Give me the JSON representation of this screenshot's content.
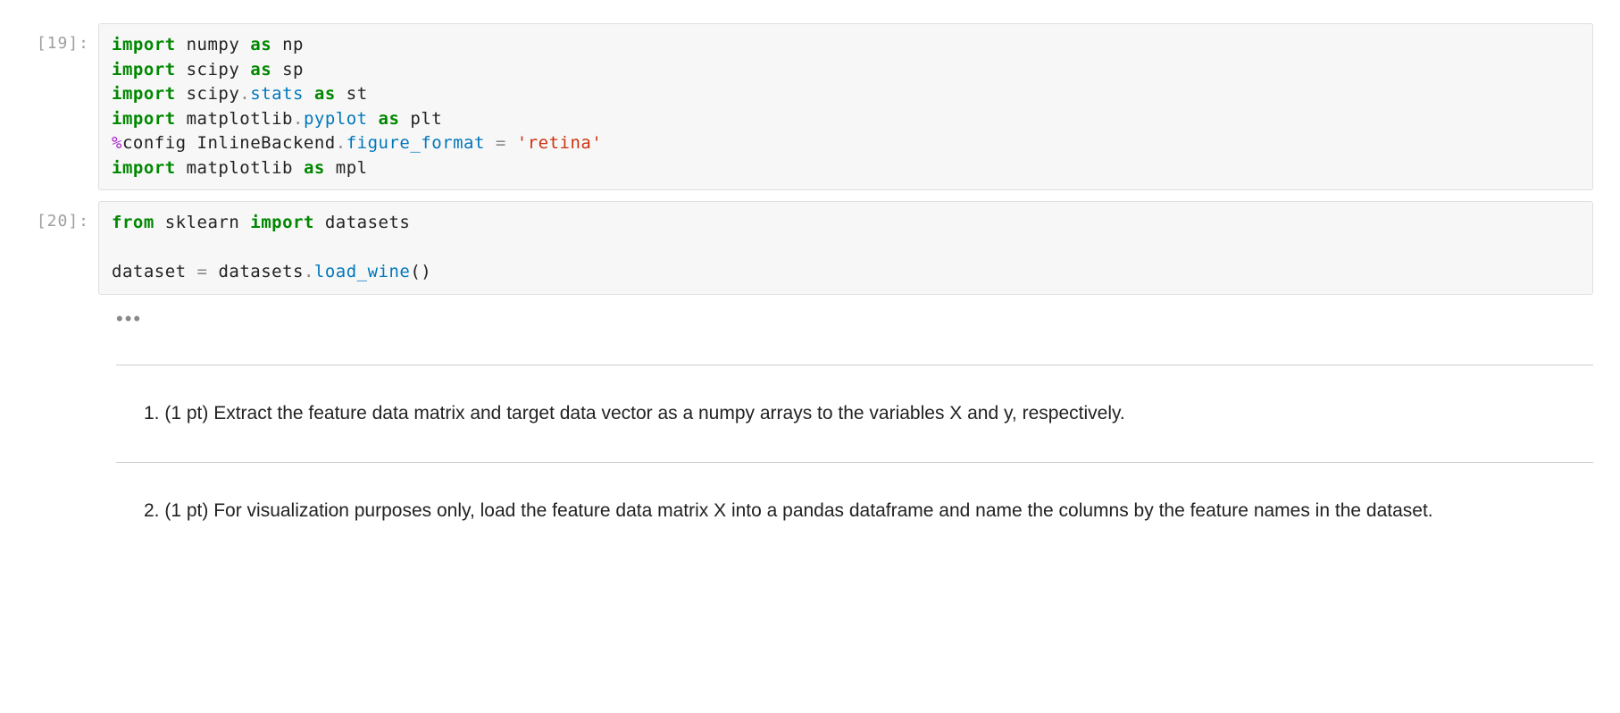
{
  "cells": {
    "cell19": {
      "prompt": "[19]:",
      "code": {
        "l1": {
          "kw1": "import",
          "sp": " ",
          "nm1": "numpy",
          "sp2": " ",
          "kw2": "as",
          "sp3": " ",
          "nm2": "np"
        },
        "l2": {
          "kw1": "import",
          "sp": " ",
          "nm1": "scipy",
          "sp2": " ",
          "kw2": "as",
          "sp3": " ",
          "nm2": "sp"
        },
        "l3": {
          "kw1": "import",
          "sp": " ",
          "nm1": "scipy",
          "dot": ".",
          "attr": "stats",
          "sp2": " ",
          "kw2": "as",
          "sp3": " ",
          "nm2": "st"
        },
        "l4": {
          "kw1": "import",
          "sp": " ",
          "nm1": "matplotlib",
          "dot": ".",
          "attr": "pyplot",
          "sp2": " ",
          "kw2": "as",
          "sp3": " ",
          "nm2": "plt"
        },
        "l5": {
          "magic": "%",
          "nm1": "config InlineBackend",
          "dot": ".",
          "attr": "figure_format",
          "sp": " ",
          "op": "=",
          "sp2": " ",
          "str": "'retina'"
        },
        "l6": {
          "kw1": "import",
          "sp": " ",
          "nm1": "matplotlib",
          "sp2": " ",
          "kw2": "as",
          "sp3": " ",
          "nm2": "mpl"
        }
      }
    },
    "cell20": {
      "prompt": "[20]:",
      "code": {
        "l1": {
          "kw1": "from",
          "sp": " ",
          "nm1": "sklearn",
          "sp2": " ",
          "kw2": "import",
          "sp3": " ",
          "nm2": "datasets"
        },
        "l2": {
          "blank": ""
        },
        "l3": {
          "nm1": "dataset",
          "sp": " ",
          "op": "=",
          "sp2": " ",
          "nm2": "datasets",
          "dot": ".",
          "attr": "load_wine",
          "paren": "()"
        }
      }
    }
  },
  "ellipsis": "•••",
  "markdown": {
    "q1": "1. (1 pt) Extract the feature data matrix and target data vector as a numpy arrays to the variables X and y, respectively.",
    "q2": "2. (1 pt) For visualization purposes only, load the feature data matrix X into a pandas dataframe and name the columns by the feature names in the dataset."
  }
}
